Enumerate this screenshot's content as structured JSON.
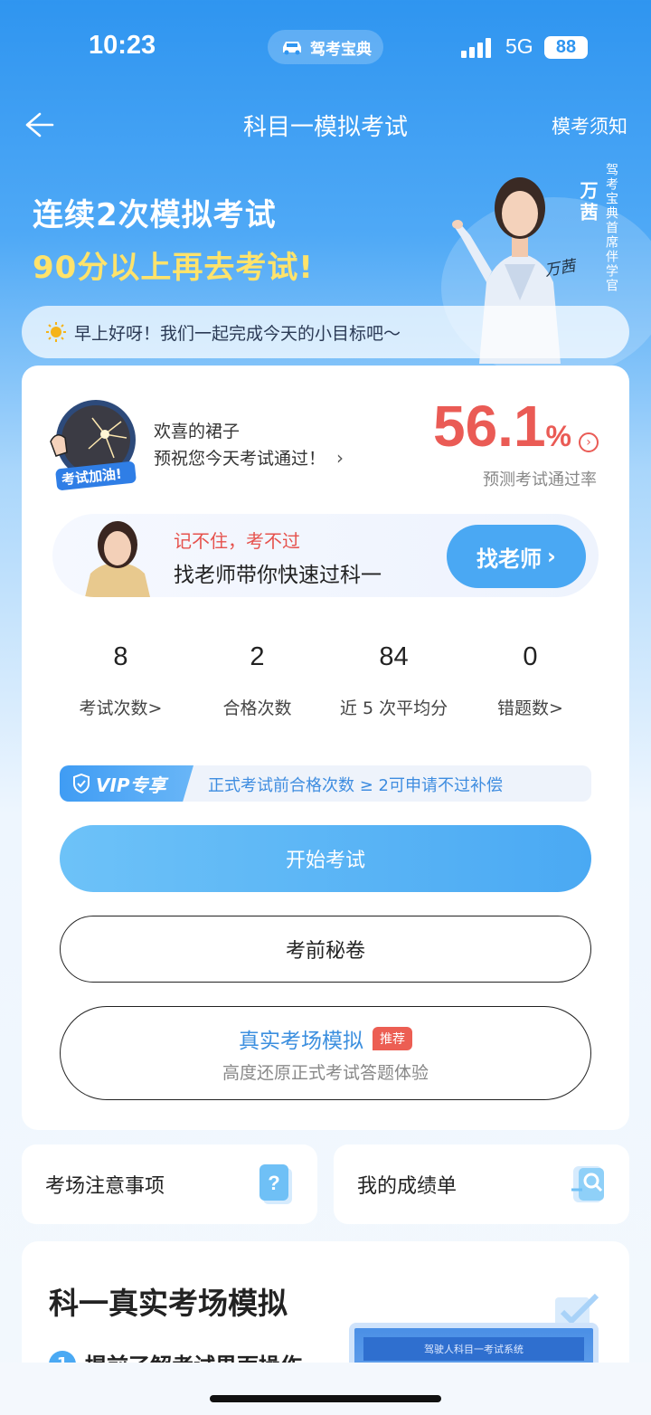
{
  "status_bar": {
    "time": "10:23",
    "app_badge": "驾考宝典",
    "network": "5G",
    "battery": "88"
  },
  "nav": {
    "title": "科目一模拟考试",
    "right_link": "模考须知"
  },
  "banner": {
    "line1": "连续2次模拟考试",
    "line2": "90分以上再去考试!",
    "presenter_name": "万茜",
    "presenter_title": "驾考宝典首席伴学官",
    "signature": "万茜"
  },
  "greeting": "早上好呀！我们一起完成今天的小目标吧～",
  "profile": {
    "name": "欢喜的裙子",
    "wish": "预祝您今天考试通过！",
    "avatar_badge": "考试加油!"
  },
  "pass_rate": {
    "value": "56.1",
    "unit": "%",
    "label": "预测考试通过率"
  },
  "teacher_promo": {
    "line1": "记不住，考不过",
    "line2": "找老师带你快速过科一",
    "button": "找老师"
  },
  "stats": [
    {
      "value": "8",
      "label": "考试次数>"
    },
    {
      "value": "2",
      "label": "合格次数"
    },
    {
      "value": "84",
      "label": "近 5 次平均分"
    },
    {
      "value": "0",
      "label": "错题数>"
    }
  ],
  "vip": {
    "tag": "VIP专享",
    "text": "正式考试前合格次数 ≥ 2可申请不过补偿"
  },
  "buttons": {
    "start": "开始考试",
    "secret": "考前秘卷",
    "real_title": "真实考场模拟",
    "real_badge": "推荐",
    "real_subtitle": "高度还原正式考试答题体验"
  },
  "quick_cards": [
    {
      "label": "考场注意事项",
      "icon": "question-doc-icon"
    },
    {
      "label": "我的成绩单",
      "icon": "score-report-icon"
    }
  ],
  "section": {
    "title": "科一真实考场模拟",
    "step_num": "1",
    "step_text": "提前了解考试界面操作",
    "preview_header": "驾驶人科目一考试系统"
  },
  "colors": {
    "primary": "#4aa9f3",
    "accent_red": "#ea5b55",
    "highlight_yellow": "#ffe36b"
  }
}
